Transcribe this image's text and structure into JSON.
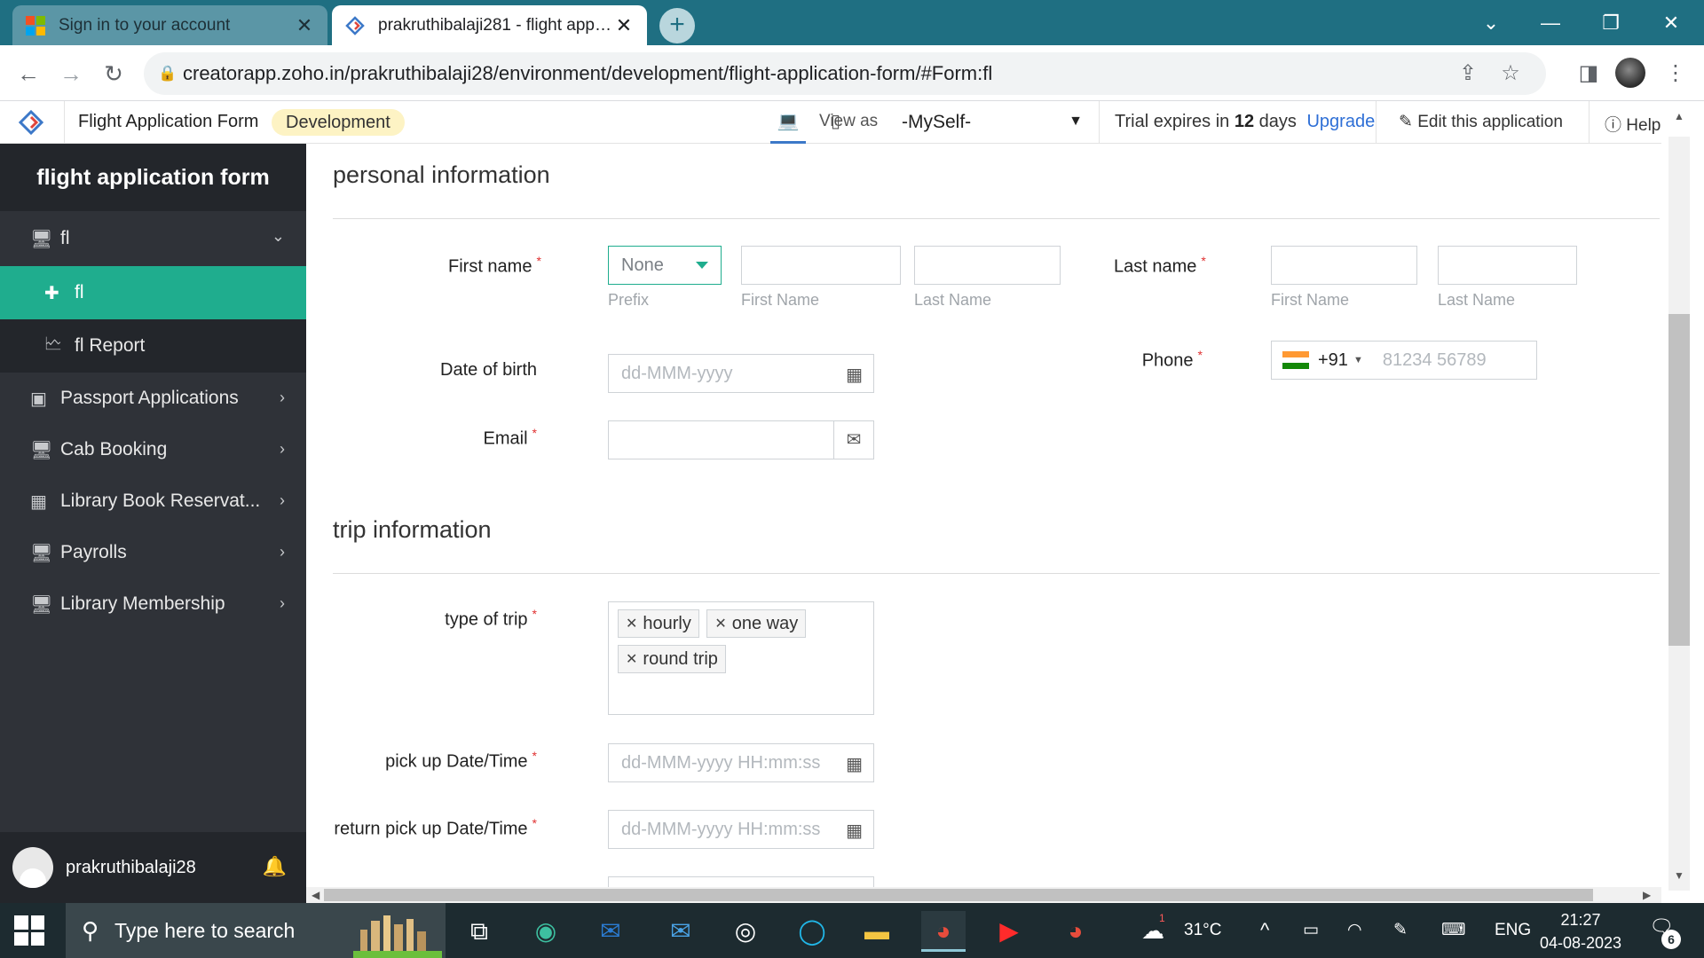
{
  "browser": {
    "tabs": [
      {
        "title": "Sign in to your account",
        "active": false
      },
      {
        "title": "prakruthibalaji281 - flight applica",
        "active": true
      }
    ],
    "new_tab": "+",
    "url": "creatorapp.zoho.in/prakruthibalaji28/environment/development/flight-application-form/#Form:fl"
  },
  "app_header": {
    "app_name": "Flight Application Form",
    "environment": "Development",
    "view_as_label": "View as",
    "view_as_value": "-MySelf-",
    "trial_prefix": "Trial expires in",
    "trial_days": "12",
    "trial_suffix": "days",
    "upgrade": "Upgrade",
    "edit_app": "Edit this application",
    "help": "Help"
  },
  "sidebar": {
    "title": "flight application form",
    "group": {
      "label": "fl",
      "icon": "monitor-icon"
    },
    "sub_items": [
      {
        "label": "fl",
        "icon": "plus-cross-icon",
        "active": true
      },
      {
        "label": "fl Report",
        "icon": "report-icon",
        "active": false
      }
    ],
    "items": [
      {
        "label": "Passport Applications",
        "icon": "passport-icon"
      },
      {
        "label": "Cab Booking",
        "icon": "monitor-icon"
      },
      {
        "label": "Library Book Reservat...",
        "icon": "grid-icon"
      },
      {
        "label": "Payrolls",
        "icon": "monitor-icon"
      },
      {
        "label": "Library Membership",
        "icon": "monitor-icon"
      }
    ],
    "user": "prakruthibalaji28"
  },
  "form": {
    "personal_section": "personal information",
    "first_name_label": "First name",
    "prefix_value": "None",
    "prefix_caption": "Prefix",
    "first_name_caption": "First Name",
    "last_name_caption": "Last Name",
    "last_name_label": "Last name",
    "last_first_caption": "First Name",
    "last_last_caption": "Last Name",
    "dob_label": "Date of birth",
    "dob_placeholder": "dd-MMM-yyyy",
    "phone_label": "Phone",
    "phone_code": "+91",
    "phone_placeholder": "81234 56789",
    "email_label": "Email",
    "trip_section": "trip information",
    "trip_type_label": "type of trip",
    "trip_types": [
      "hourly",
      "one way",
      "round trip"
    ],
    "pickup_label": "pick up Date/Time",
    "pickup_placeholder": "dd-MMM-yyyy HH:mm:ss",
    "return_label": "return pick up Date/Time",
    "return_placeholder": "dd-MMM-yyyy HH:mm:ss",
    "required_mark": "*"
  },
  "taskbar": {
    "search_placeholder": "Type here to search",
    "weather": "31°C",
    "weather_badge": "1",
    "language": "ENG",
    "time": "21:27",
    "date": "04-08-2023",
    "notifications": "6"
  },
  "colors": {
    "accent": "#1fad8e",
    "sidebar_bg": "#2f3238",
    "tabstrip": "#1f6f82",
    "required": "#e03131",
    "link": "#2e6fd6"
  }
}
